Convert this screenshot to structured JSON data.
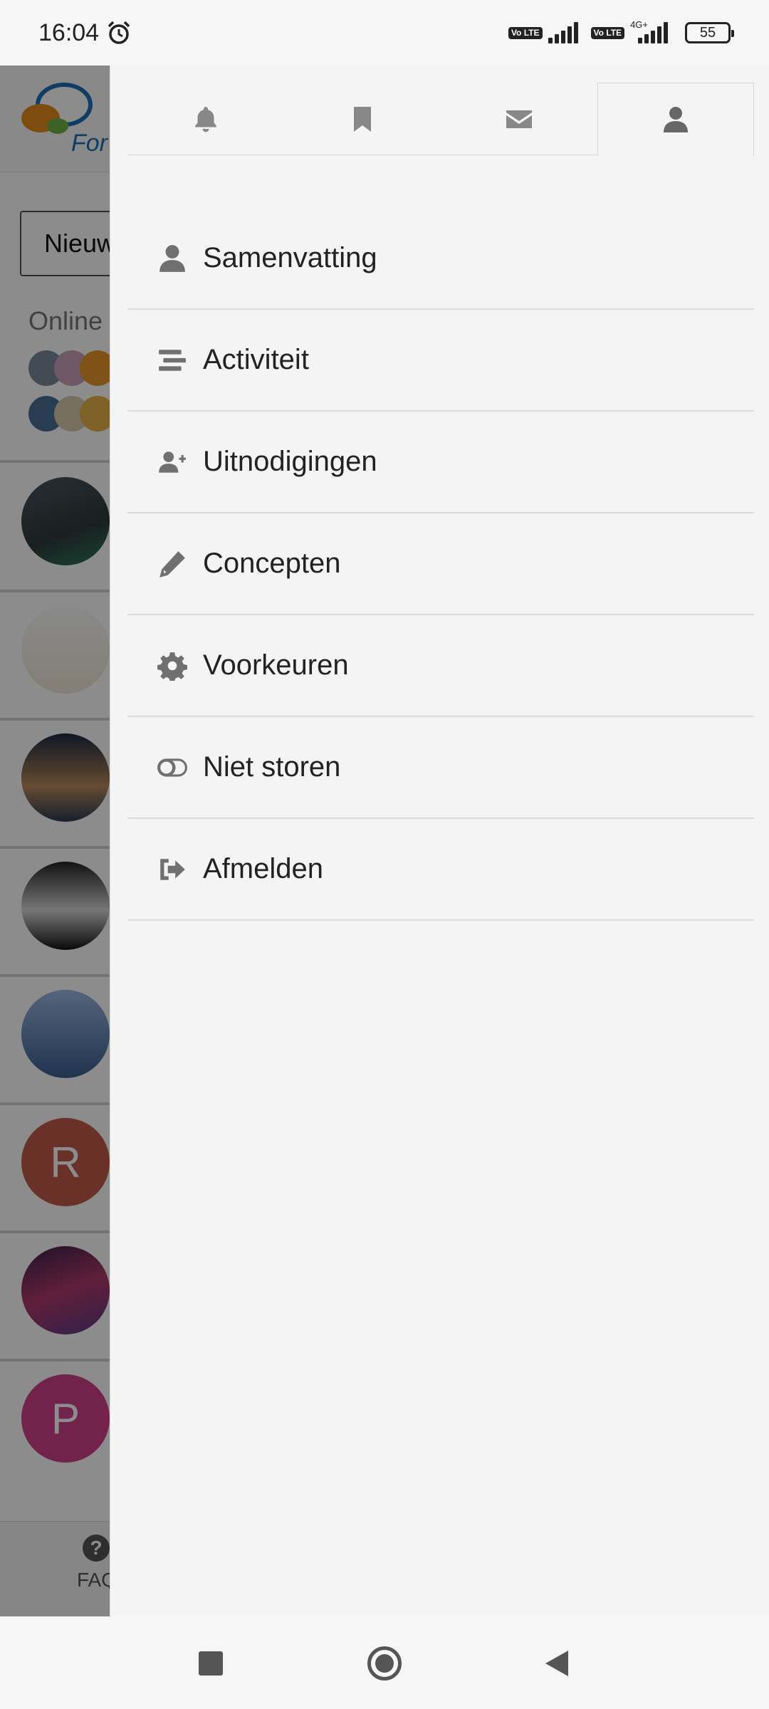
{
  "status_bar": {
    "time": "16:04",
    "sim1_badge": "Vo LTE",
    "sim2_badge": "Vo LTE",
    "network_type": "4G+",
    "battery": "55"
  },
  "background": {
    "logo_text": "For",
    "select_value": "Nieuw",
    "online_label": "Online",
    "avatar_letters": [
      "R",
      "P"
    ],
    "footer_label": "FAQ",
    "faq_icon_glyph": "?"
  },
  "drawer": {
    "tabs": [
      {
        "name": "notifications",
        "icon": "bell-icon"
      },
      {
        "name": "bookmarks",
        "icon": "bookmark-icon"
      },
      {
        "name": "messages",
        "icon": "envelope-icon"
      },
      {
        "name": "profile",
        "icon": "user-icon",
        "active": true
      }
    ],
    "menu": [
      {
        "label": "Samenvatting",
        "icon": "user-icon"
      },
      {
        "label": "Activiteit",
        "icon": "stream-icon"
      },
      {
        "label": "Uitnodigingen",
        "icon": "user-plus-icon"
      },
      {
        "label": "Concepten",
        "icon": "pencil-icon"
      },
      {
        "label": "Voorkeuren",
        "icon": "cog-icon"
      },
      {
        "label": "Niet storen",
        "icon": "toggle-off-icon"
      },
      {
        "label": "Afmelden",
        "icon": "sign-out-icon"
      }
    ]
  },
  "colors": {
    "drawer_bg": "#f4f4f4",
    "icon_gray": "#707070",
    "overlay": "rgba(0,0,0,0.45)"
  }
}
